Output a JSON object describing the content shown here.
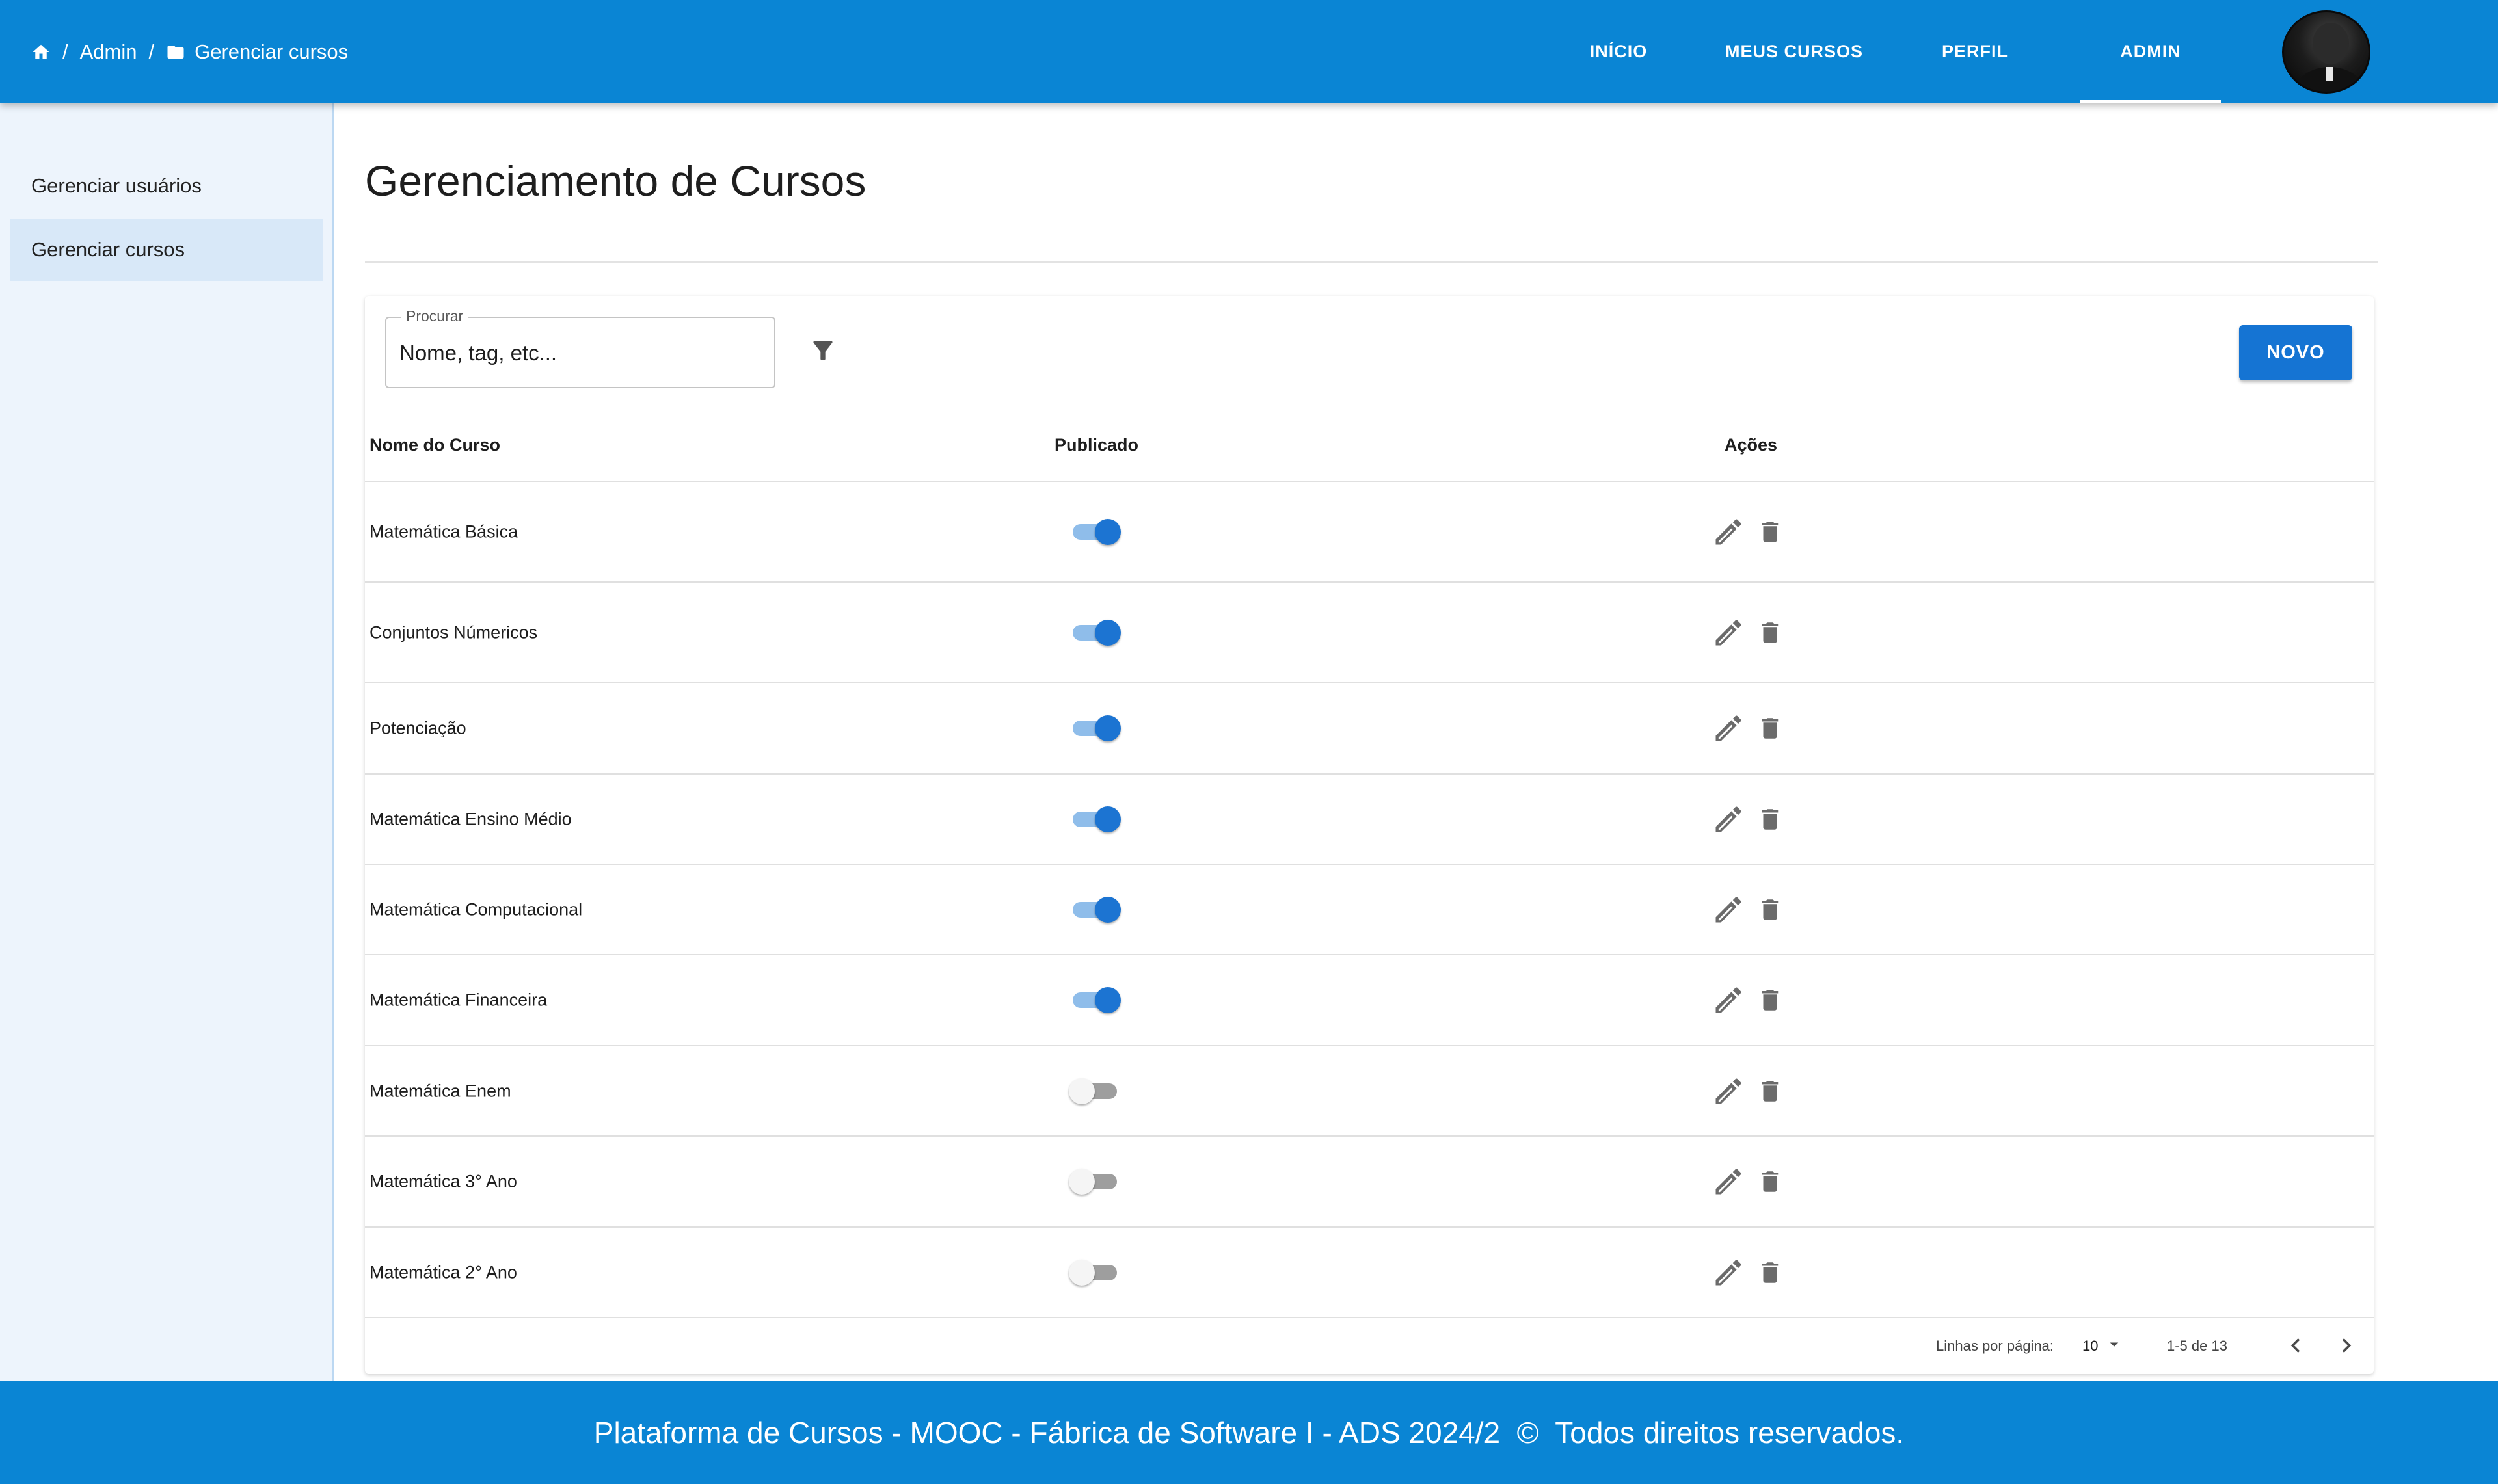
{
  "breadcrumb": {
    "home_icon": "home-icon",
    "folder_icon": "folder-icon",
    "items": [
      "Admin",
      "Gerenciar cursos"
    ],
    "separator": "/"
  },
  "nav": {
    "items": [
      "INÍCIO",
      "MEUS CURSOS",
      "PERFIL",
      "ADMIN"
    ],
    "active": "ADMIN"
  },
  "sidebar": {
    "items": [
      {
        "label": "Gerenciar usuários",
        "selected": false
      },
      {
        "label": "Gerenciar cursos",
        "selected": true
      }
    ]
  },
  "main": {
    "title": "Gerenciamento de Cursos",
    "search": {
      "label": "Procurar",
      "placeholder": "Nome, tag, etc..."
    },
    "new_button": "NOVO",
    "columns": [
      "Nome do Curso",
      "Publicado",
      "Ações"
    ],
    "rows": [
      {
        "name": "Matemática Básica",
        "published": true
      },
      {
        "name": "Conjuntos Númericos",
        "published": true
      },
      {
        "name": "Potenciação",
        "published": true
      },
      {
        "name": "Matemática Ensino Médio",
        "published": true
      },
      {
        "name": "Matemática Computacional",
        "published": true
      },
      {
        "name": "Matemática Financeira",
        "published": true
      },
      {
        "name": "Matemática Enem",
        "published": false
      },
      {
        "name": "Matemática 3° Ano",
        "published": false
      },
      {
        "name": "Matemática 2° Ano",
        "published": false
      }
    ],
    "pagination": {
      "rows_per_page_label": "Linhas por página:",
      "rows_per_page": "10",
      "range": "1-5 de 13"
    }
  },
  "footer": {
    "text": "Plataforma de Cursos - MOOC - Fábrica de Software I - ADS 2024/2  ©  Todos direitos reservados."
  },
  "colors": {
    "primary": "#0a85d4",
    "button": "#1574d3",
    "sidebar_bg": "#edf4fc",
    "toggle_on": "#1c74d2"
  }
}
